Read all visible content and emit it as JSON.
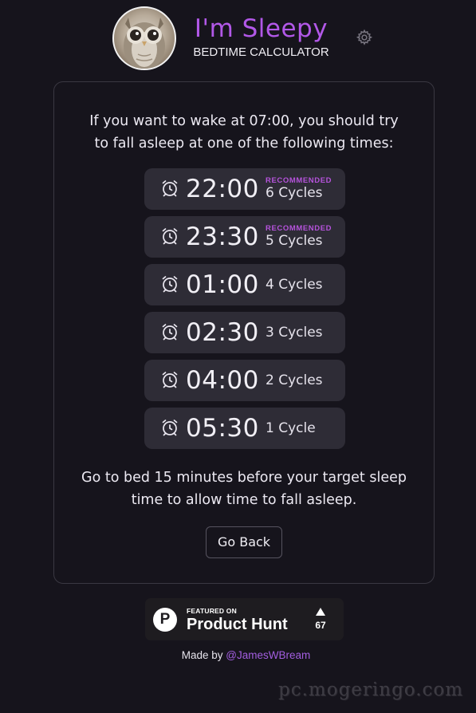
{
  "header": {
    "title": "I'm Sleepy",
    "subtitle": "BEDTIME CALCULATOR",
    "avatar_icon": "owl-avatar",
    "settings_icon": "gear-icon"
  },
  "card": {
    "intro_line1": "If you want to wake at 07:00, you should try",
    "intro_line2": "to fall asleep at one of the following times:",
    "times": [
      {
        "time": "22:00",
        "cycles": "6 Cycles",
        "badge": "RECOMMENDED"
      },
      {
        "time": "23:30",
        "cycles": "5 Cycles",
        "badge": "RECOMMENDED"
      },
      {
        "time": "01:00",
        "cycles": "4 Cycles",
        "badge": ""
      },
      {
        "time": "02:30",
        "cycles": "3 Cycles",
        "badge": ""
      },
      {
        "time": "04:00",
        "cycles": "2 Cycles",
        "badge": ""
      },
      {
        "time": "05:30",
        "cycles": "1 Cycle",
        "badge": ""
      }
    ],
    "note_line1": "Go to bed 15 minutes before your target sleep",
    "note_line2": "time to allow time to fall asleep.",
    "back_label": "Go Back"
  },
  "product_hunt": {
    "featured": "FEATURED ON",
    "name": "Product Hunt",
    "logo_letter": "P",
    "votes": "67"
  },
  "footer": {
    "made_by": "Made by",
    "author": "@JamesWBream"
  },
  "watermark": "pc.mogeringo.com",
  "colors": {
    "background": "#16141c",
    "accent": "#b258e8",
    "badge": "#b653dc",
    "item_bg": "#2e2c36"
  }
}
